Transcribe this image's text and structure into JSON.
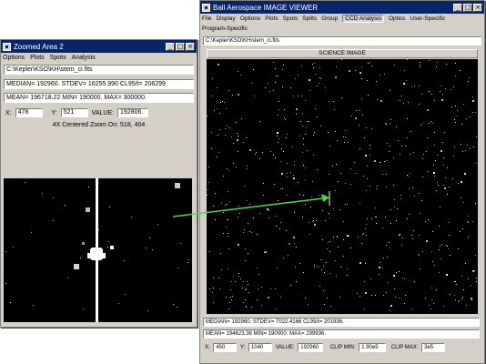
{
  "zoom_window": {
    "title": "Zoomed Area 2",
    "menu": [
      "Options",
      "Plots",
      "Spots",
      "Analysis"
    ],
    "file_path": "C:\\Kepler\\KSO\\KH\\stem_ci.fits",
    "stats_line1": "MEDIAN= 192960. STDEV= 16255.990 CL95/t= 206299.",
    "stats_line2": "MEAN= 196718.22 MIN= 190000. MAX= 300000.",
    "x_label": "X:",
    "x_value": "478",
    "y_label": "Y:",
    "y_value": "521",
    "value_label": "VALUE:",
    "value": "192806.",
    "zoom_caption": "4X Centered Zoom On: 518, 404"
  },
  "viewer_window": {
    "title": "Ball Aerospace IMAGE VIEWER",
    "menu": [
      "File",
      "Display",
      "Options",
      "Plots",
      "Spots",
      "Splits",
      "Group",
      "CCD Analysis",
      "Optics",
      "User-Specific"
    ],
    "menu_pressed": "CCD Analysis",
    "menu2": [
      "Program-Specific"
    ],
    "file_path": "C:\\Kepler\\KSO\\KH\\stem_ci.fits",
    "image_title": "SCIENCE IMAGE",
    "stats_line1": "MEDIAN= 192960. STDEV= 7022.4166 CL95/t= 201936.",
    "stats_line2": "MEAN= 194623.38 MIN= 190000. MAX= 299936.",
    "x_label": "X:",
    "x_value": "450",
    "y_label": "Y:",
    "y_value": "1040",
    "value_label": "VALUE:",
    "value": "192960",
    "clip_min_label": "CLIP MIN:",
    "clip_min": "1.90e5",
    "clip_max_label": "CLIP MAX:",
    "clip_max": "3e5"
  },
  "colors": {
    "titlebar": "#0a246a",
    "window_bg": "#d4d0c8",
    "arrow": "#44dd44"
  },
  "buttons": {
    "minimize": "_",
    "maximize": "□",
    "close": "×"
  }
}
